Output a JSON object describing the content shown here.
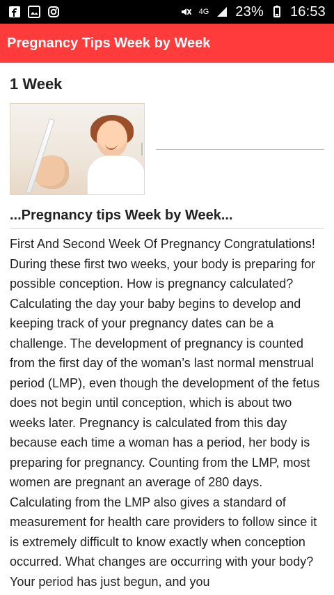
{
  "status_bar": {
    "left_icons": [
      "facebook-icon",
      "photo-icon",
      "instagram-icon"
    ],
    "right": {
      "network": "4G",
      "battery": "23%",
      "time": "16:53"
    }
  },
  "app_bar": {
    "title": "Pregnancy Tips Week by Week",
    "color": "#ff3b3b"
  },
  "content": {
    "week_title": "1 Week",
    "section_title": "...Pregnancy tips Week by Week...",
    "body": "First And Second Week Of Pregnancy Congratulations! During these first two weeks, your body is preparing for possible conception. How is pregnancy calculated? Calculating the day your baby begins to develop and keeping track of your pregnancy dates can be a challenge. The development of pregnancy is counted from the first day of the woman’s last normal menstrual period (LMP), even though the development of the fetus does not begin until conception, which is about two weeks later. Pregnancy is calculated from this day because each time a woman has a period, her body is preparing for pregnancy. Counting from the LMP, most women are pregnant an average of 280 days. Calculating from the LMP also gives a standard of measurement for health care providers to follow since it is extremely difficult to know exactly when conception occurred. What changes are occurring with your body? Your period has just begun, and you"
  }
}
